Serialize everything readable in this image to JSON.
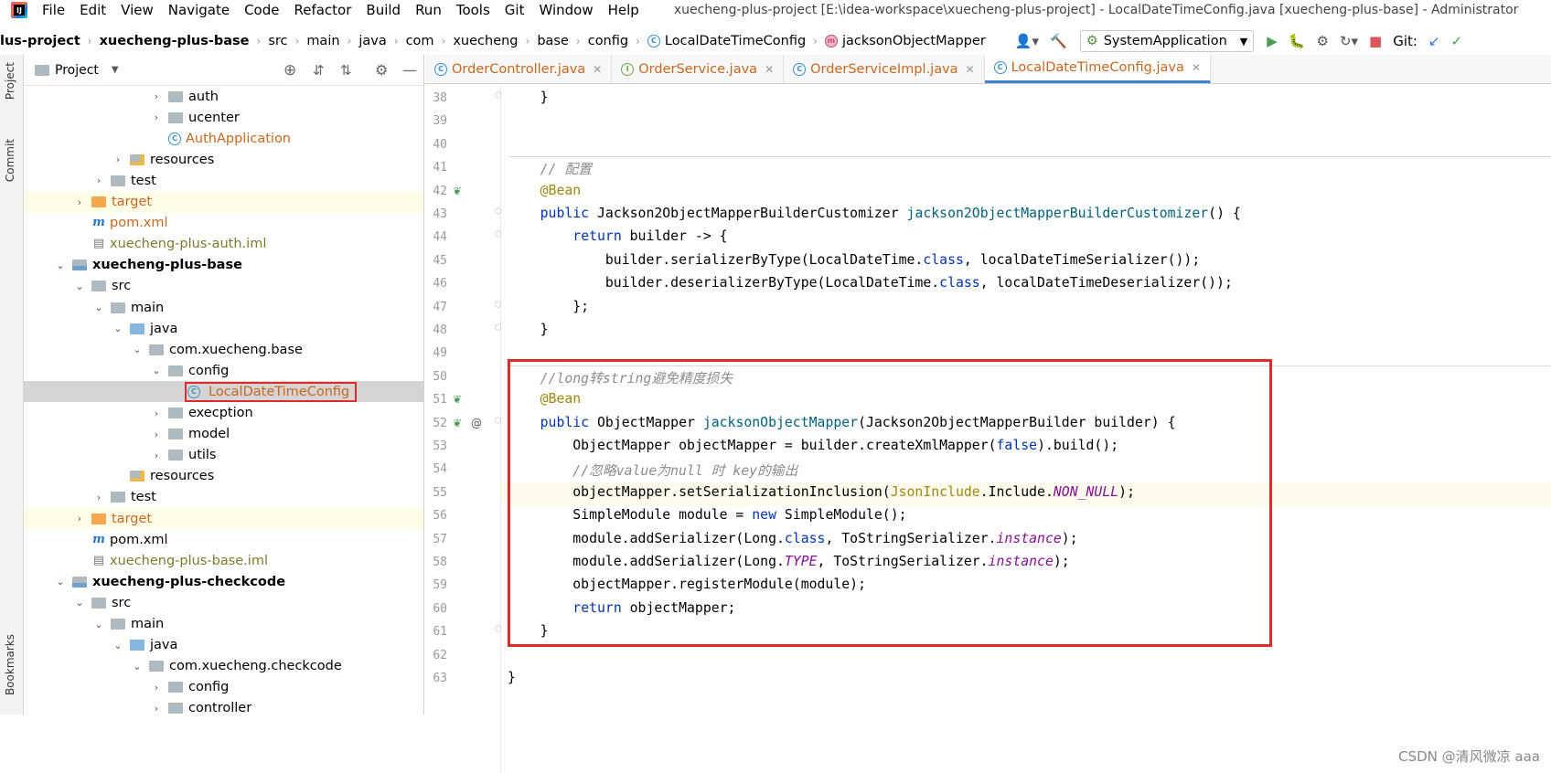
{
  "menubar": {
    "items": [
      "File",
      "Edit",
      "View",
      "Navigate",
      "Code",
      "Refactor",
      "Build",
      "Run",
      "Tools",
      "Git",
      "Window",
      "Help"
    ],
    "window_title": "xuecheng-plus-project [E:\\idea-workspace\\xuecheng-plus-project] - LocalDateTimeConfig.java [xuecheng-plus-base] - Administrator"
  },
  "navbar": {
    "crumbs": [
      "lus-project",
      "xuecheng-plus-base",
      "src",
      "main",
      "java",
      "com",
      "xuecheng",
      "base",
      "config",
      "LocalDateTimeConfig",
      "jacksonObjectMapper"
    ],
    "run_config": "SystemApplication",
    "git_label": "Git:"
  },
  "leftstrip": {
    "project": "Project",
    "commit": "Commit",
    "bookmarks": "Bookmarks"
  },
  "project_panel": {
    "title": "Project",
    "tree": [
      {
        "label": "auth",
        "depth": 6,
        "arrow": "›",
        "icon": "pkg",
        "style": ""
      },
      {
        "label": "ucenter",
        "depth": 6,
        "arrow": "›",
        "icon": "pkg",
        "style": ""
      },
      {
        "label": "AuthApplication",
        "depth": 6,
        "arrow": "",
        "icon": "class",
        "style": "orange"
      },
      {
        "label": "resources",
        "depth": 4,
        "arrow": "›",
        "icon": "res",
        "style": ""
      },
      {
        "label": "test",
        "depth": 3,
        "arrow": "›",
        "icon": "folder",
        "style": ""
      },
      {
        "label": "target",
        "depth": 2,
        "arrow": "›",
        "icon": "orange",
        "style": "orange",
        "hl": true
      },
      {
        "label": "pom.xml",
        "depth": 2,
        "arrow": "",
        "icon": "mvn",
        "style": "orange"
      },
      {
        "label": "xuecheng-plus-auth.iml",
        "depth": 2,
        "arrow": "",
        "icon": "iml",
        "style": "olive"
      },
      {
        "label": "xuecheng-plus-base",
        "depth": 1,
        "arrow": "⌄",
        "icon": "mod",
        "style": "bold"
      },
      {
        "label": "src",
        "depth": 2,
        "arrow": "⌄",
        "icon": "folder",
        "style": ""
      },
      {
        "label": "main",
        "depth": 3,
        "arrow": "⌄",
        "icon": "folder",
        "style": ""
      },
      {
        "label": "java",
        "depth": 4,
        "arrow": "⌄",
        "icon": "blue",
        "style": ""
      },
      {
        "label": "com.xuecheng.base",
        "depth": 5,
        "arrow": "⌄",
        "icon": "pkg",
        "style": ""
      },
      {
        "label": "config",
        "depth": 6,
        "arrow": "⌄",
        "icon": "pkg",
        "style": ""
      },
      {
        "label": "LocalDateTimeConfig",
        "depth": 7,
        "arrow": "",
        "icon": "class",
        "style": "orange",
        "sel": true
      },
      {
        "label": "execption",
        "depth": 6,
        "arrow": "›",
        "icon": "pkg",
        "style": ""
      },
      {
        "label": "model",
        "depth": 6,
        "arrow": "›",
        "icon": "pkg",
        "style": ""
      },
      {
        "label": "utils",
        "depth": 6,
        "arrow": "›",
        "icon": "pkg",
        "style": ""
      },
      {
        "label": "resources",
        "depth": 4,
        "arrow": "",
        "icon": "res",
        "style": ""
      },
      {
        "label": "test",
        "depth": 3,
        "arrow": "›",
        "icon": "folder",
        "style": ""
      },
      {
        "label": "target",
        "depth": 2,
        "arrow": "›",
        "icon": "orange",
        "style": "orange",
        "hl": true
      },
      {
        "label": "pom.xml",
        "depth": 2,
        "arrow": "",
        "icon": "mvn",
        "style": ""
      },
      {
        "label": "xuecheng-plus-base.iml",
        "depth": 2,
        "arrow": "",
        "icon": "iml",
        "style": "olive"
      },
      {
        "label": "xuecheng-plus-checkcode",
        "depth": 1,
        "arrow": "⌄",
        "icon": "mod",
        "style": "bold"
      },
      {
        "label": "src",
        "depth": 2,
        "arrow": "⌄",
        "icon": "folder",
        "style": ""
      },
      {
        "label": "main",
        "depth": 3,
        "arrow": "⌄",
        "icon": "folder",
        "style": ""
      },
      {
        "label": "java",
        "depth": 4,
        "arrow": "⌄",
        "icon": "blue",
        "style": ""
      },
      {
        "label": "com.xuecheng.checkcode",
        "depth": 5,
        "arrow": "⌄",
        "icon": "pkg",
        "style": ""
      },
      {
        "label": "config",
        "depth": 6,
        "arrow": "›",
        "icon": "pkg",
        "style": ""
      },
      {
        "label": "controller",
        "depth": 6,
        "arrow": "›",
        "icon": "pkg",
        "style": ""
      }
    ]
  },
  "tabs": [
    {
      "label": "OrderController.java",
      "icon": "C",
      "active": false
    },
    {
      "label": "OrderService.java",
      "icon": "I",
      "active": false
    },
    {
      "label": "OrderServiceImpl.java",
      "icon": "C",
      "active": false
    },
    {
      "label": "LocalDateTimeConfig.java",
      "icon": "C",
      "active": true
    }
  ],
  "editor": {
    "lines": [
      {
        "n": "38",
        "html": "    <span>}</span>"
      },
      {
        "n": "39",
        "html": ""
      },
      {
        "n": "40",
        "html": ""
      },
      {
        "n": "41",
        "html": "    <span class=\"cm\">// 配置</span>"
      },
      {
        "n": "42",
        "html": "    <span class=\"an\">@Bean</span>"
      },
      {
        "n": "43",
        "html": "    <span class=\"kw\">public</span> Jackson2ObjectMapperBuilderCustomizer <span class=\"fn\">jackson2ObjectMapperBuilderCustomizer</span>() {"
      },
      {
        "n": "44",
        "html": "        <span class=\"kw\">return</span> builder -&gt; {"
      },
      {
        "n": "45",
        "html": "            builder.serializerByType(LocalDateTime.<span class=\"kw\">class</span>, localDateTimeSerializer());"
      },
      {
        "n": "46",
        "html": "            builder.deserializerByType(LocalDateTime.<span class=\"kw\">class</span>, localDateTimeDeserializer());"
      },
      {
        "n": "47",
        "html": "        };"
      },
      {
        "n": "48",
        "html": "    }"
      },
      {
        "n": "49",
        "html": ""
      },
      {
        "n": "50",
        "html": "    <span class=\"cm\">//long转string避免精度损失</span>"
      },
      {
        "n": "51",
        "html": "    <span class=\"an\">@Bean</span>"
      },
      {
        "n": "52",
        "html": "    <span class=\"kw\">public</span> ObjectMapper <span class=\"fn\">jacksonObjectMapper</span>(Jackson2ObjectMapperBuilder builder) {"
      },
      {
        "n": "53",
        "html": "        ObjectMapper objectMapper = builder.createXmlMapper(<span class=\"kw\">false</span>).build();"
      },
      {
        "n": "54",
        "html": "        <span class=\"cm\">//忽略value为null 时 key的输出</span>"
      },
      {
        "n": "55",
        "html": "        objectMapper.setSerializationInclusion(<span class=\"an\">JsonInclude</span>.Include.<span class=\"st\">NON_NULL</span>);"
      },
      {
        "n": "56",
        "html": "        SimpleModule module = <span class=\"kw\">new</span> SimpleModule();"
      },
      {
        "n": "57",
        "html": "        module.addSerializer(Long.<span class=\"kw\">class</span>, ToStringSerializer.<span class=\"st\">instance</span>);"
      },
      {
        "n": "58",
        "html": "        module.addSerializer(Long.<span class=\"st\">TYPE</span>, ToStringSerializer.<span class=\"st\">instance</span>);"
      },
      {
        "n": "59",
        "html": "        objectMapper.registerModule(module);"
      },
      {
        "n": "60",
        "html": "        <span class=\"kw\">return</span> objectMapper;"
      },
      {
        "n": "61",
        "html": "    }"
      },
      {
        "n": "62",
        "html": ""
      },
      {
        "n": "63",
        "html": "}"
      }
    ]
  },
  "watermark": "CSDN @清风微凉 aaa"
}
